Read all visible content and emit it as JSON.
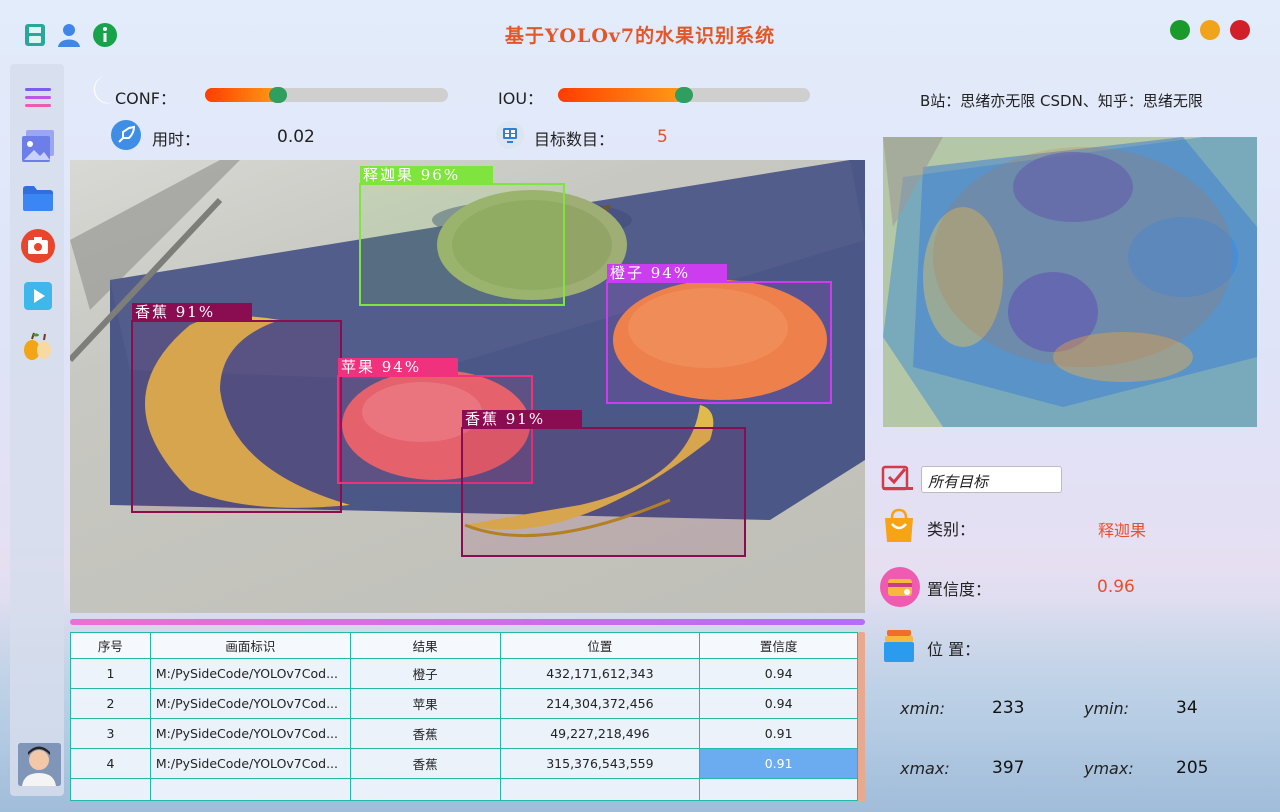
{
  "app": {
    "title": "基于YOLOv7的水果识别系统"
  },
  "toolbar": {
    "icons": [
      "save-icon",
      "user-icon",
      "info-icon"
    ]
  },
  "window_controls": [
    "minimize",
    "maximize",
    "close"
  ],
  "sidebar": {
    "items": [
      "menu-icon",
      "image-icon",
      "folder-icon",
      "camera-icon",
      "video-icon",
      "fruit-icon"
    ],
    "avatar": "avatar"
  },
  "params": {
    "conf_label": "CONF：",
    "conf_value": 0.3,
    "iou_label": "IOU：",
    "iou_value": 0.5,
    "time_label": "用时：",
    "time_value": "0.02",
    "count_label": "目标数目：",
    "count_value": "5"
  },
  "credits": "B站：思绪亦无限  CSDN、知乎：思绪无限",
  "detections": [
    {
      "label": "释迦果 96%",
      "color": "#7fe43e"
    },
    {
      "label": "橙子 94%",
      "color": "#cc3df0"
    },
    {
      "label": "香蕉 91%",
      "color": "#8a0d52"
    },
    {
      "label": "苹果 94%",
      "color": "#f0317e"
    },
    {
      "label": "香蕉 91%",
      "color": "#8a0d52"
    }
  ],
  "table": {
    "headers": [
      "序号",
      "画面标识",
      "结果",
      "位置",
      "置信度"
    ],
    "rows": [
      [
        "1",
        "M:/PySideCode/YOLOv7Cod...",
        "橙子",
        "432,171,612,343",
        "0.94"
      ],
      [
        "2",
        "M:/PySideCode/YOLOv7Cod...",
        "苹果",
        "214,304,372,456",
        "0.94"
      ],
      [
        "3",
        "M:/PySideCode/YOLOv7Cod...",
        "香蕉",
        "49,227,218,496",
        "0.91"
      ],
      [
        "4",
        "M:/PySideCode/YOLOv7Cod...",
        "香蕉",
        "315,376,543,559",
        "0.91"
      ]
    ],
    "selected_row": 4
  },
  "result": {
    "target_select": "所有目标",
    "class_label": "类别：",
    "class_value": "释迦果",
    "conf_label": "置信度：",
    "conf_value": "0.96",
    "pos_label": "位 置：",
    "xmin_label": "xmin:",
    "xmin": "233",
    "ymin_label": "ymin:",
    "ymin": "34",
    "xmax_label": "xmax:",
    "xmax": "397",
    "ymax_label": "ymax:",
    "ymax": "205"
  },
  "colors": {
    "title": "#e2572a",
    "accent_value": "#e8502a",
    "table_border": "#24b9a4",
    "selection": "#6aacef"
  }
}
